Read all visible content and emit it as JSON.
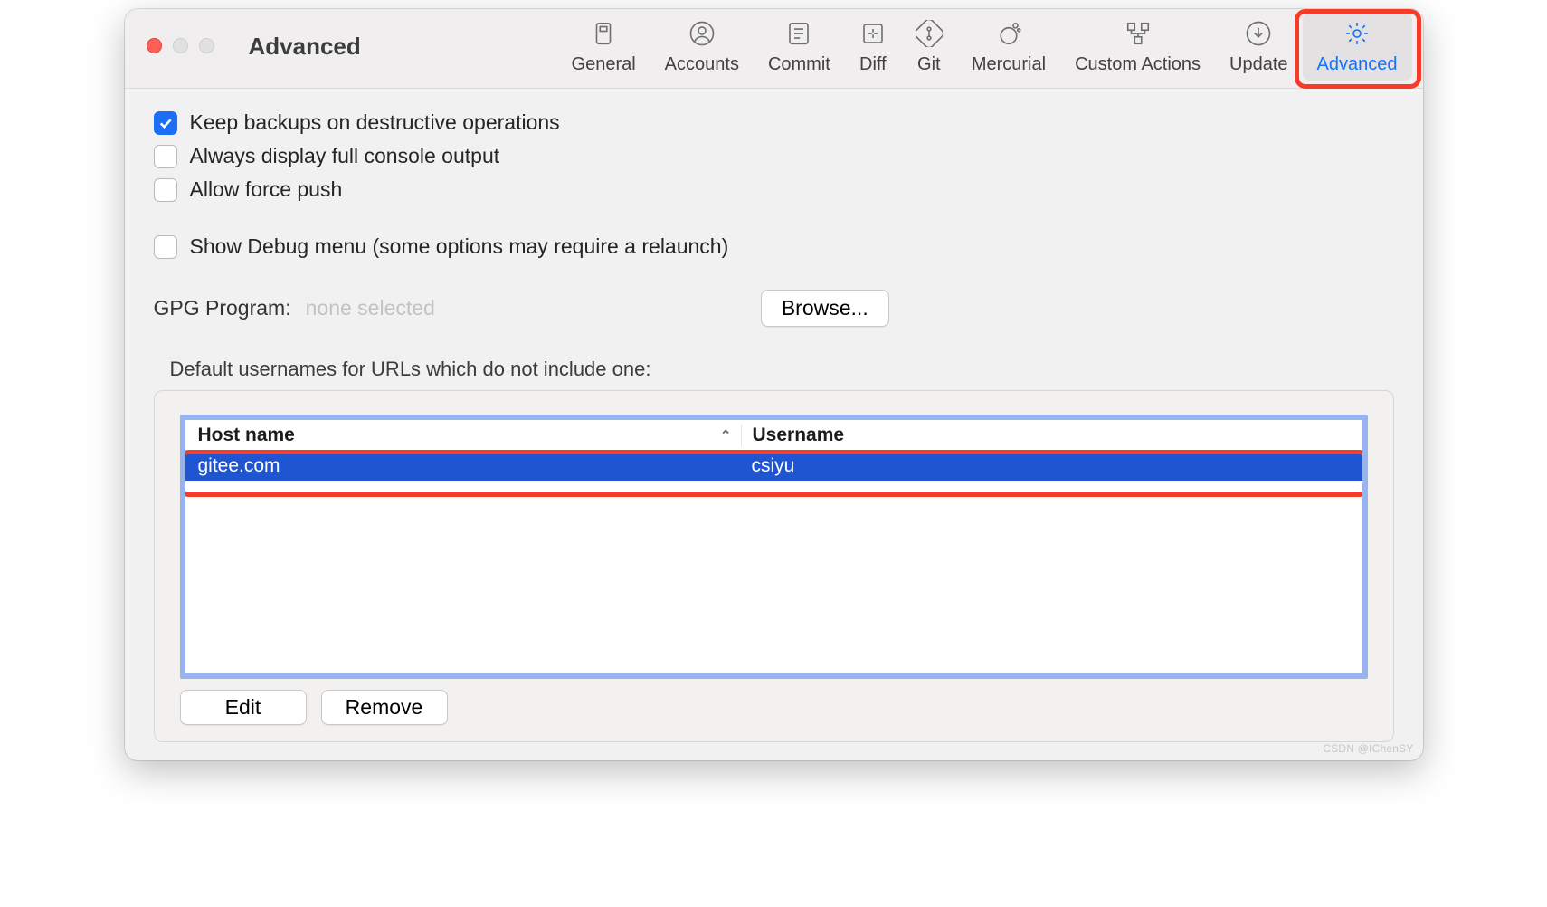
{
  "window": {
    "title": "Advanced"
  },
  "toolbar": {
    "tabs": [
      {
        "id": "general",
        "label": "General",
        "icon": "general-icon",
        "active": false
      },
      {
        "id": "accounts",
        "label": "Accounts",
        "icon": "accounts-icon",
        "active": false
      },
      {
        "id": "commit",
        "label": "Commit",
        "icon": "commit-icon",
        "active": false
      },
      {
        "id": "diff",
        "label": "Diff",
        "icon": "diff-icon",
        "active": false
      },
      {
        "id": "git",
        "label": "Git",
        "icon": "git-icon",
        "active": false
      },
      {
        "id": "mercurial",
        "label": "Mercurial",
        "icon": "mercurial-icon",
        "active": false
      },
      {
        "id": "custom",
        "label": "Custom Actions",
        "icon": "custom-icon",
        "active": false
      },
      {
        "id": "update",
        "label": "Update",
        "icon": "update-icon",
        "active": false
      },
      {
        "id": "advanced",
        "label": "Advanced",
        "icon": "gear-icon",
        "active": true
      }
    ]
  },
  "checkboxes": {
    "keep_backups": {
      "label": "Keep backups on destructive operations",
      "checked": true
    },
    "full_console": {
      "label": "Always display full console output",
      "checked": false
    },
    "force_push": {
      "label": "Allow force push",
      "checked": false
    },
    "debug_menu": {
      "label": "Show Debug menu (some options may require a relaunch)",
      "checked": false
    }
  },
  "gpg": {
    "label": "GPG Program:",
    "value": "none selected",
    "browse_label": "Browse..."
  },
  "usernames": {
    "section_label": "Default usernames for URLs which do not include one:",
    "columns": {
      "host": "Host name",
      "user": "Username"
    },
    "rows": [
      {
        "host": "gitee.com",
        "user": "csiyu",
        "selected": true
      }
    ],
    "edit_label": "Edit",
    "remove_label": "Remove"
  },
  "watermark": "CSDN @IChenSY"
}
